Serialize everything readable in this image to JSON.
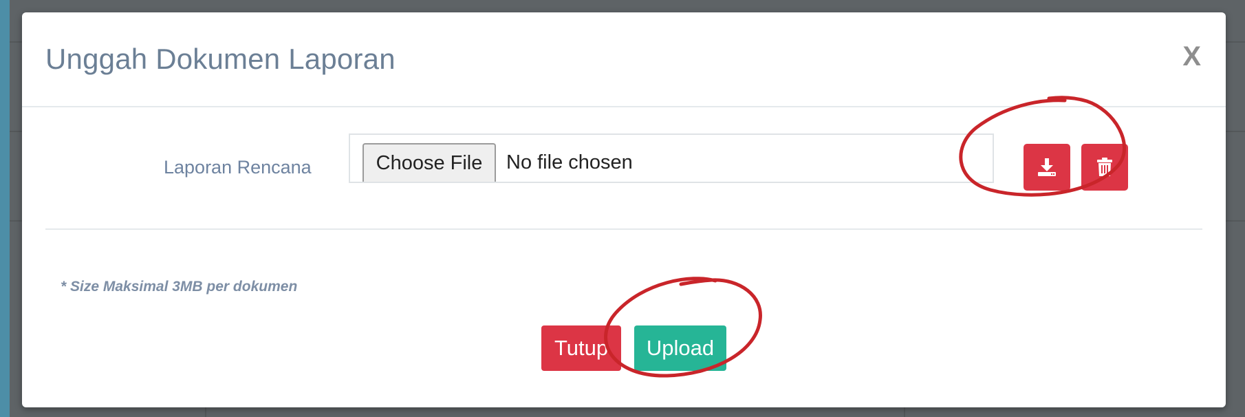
{
  "modal": {
    "title": "Unggah Dokumen Laporan",
    "close_label": "X"
  },
  "form": {
    "field_label": "Laporan Rencana",
    "file_button_label": "Choose File",
    "file_status": "No file chosen"
  },
  "actions": {
    "download_icon": "download-icon",
    "delete_icon": "trash-icon"
  },
  "note": "* Size Maksimal 3MB per dokumen",
  "footer": {
    "close_label": "Tutup",
    "upload_label": "Upload"
  },
  "colors": {
    "danger": "#dc3545",
    "success": "#26b596",
    "title": "#6b7f95",
    "annotation": "#c9252a"
  }
}
